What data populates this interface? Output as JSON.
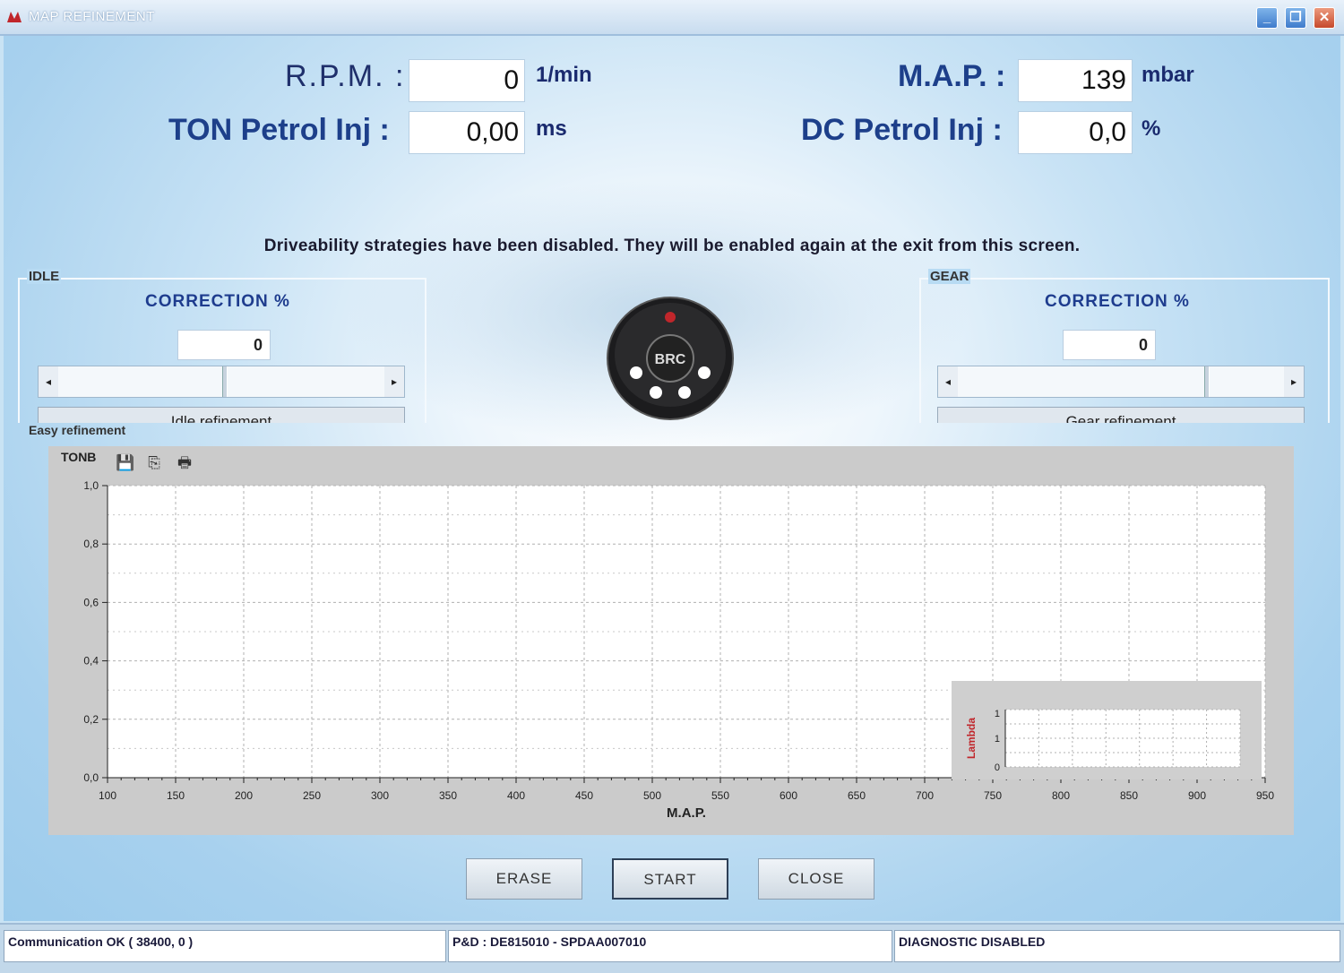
{
  "window": {
    "title": "MAP REFINEMENT"
  },
  "readouts": {
    "rpm": {
      "label": "R.P.M. :",
      "value": "0",
      "unit": "1/min"
    },
    "ton": {
      "label": "TON Petrol Inj :",
      "value": "0,00",
      "unit": "ms"
    },
    "map": {
      "label": "M.A.P. :",
      "value": "139",
      "unit": "mbar"
    },
    "dc": {
      "label": "DC Petrol Inj :",
      "value": "0,0",
      "unit": "%"
    }
  },
  "notice": "Driveability strategies have been disabled. They will be enabled again at the exit from this screen.",
  "idle": {
    "title": "IDLE",
    "correction_label": "CORRECTION %",
    "correction_value": "0",
    "slider_position": 0.5,
    "refine_button": "Idle refinement"
  },
  "gear": {
    "title": "GEAR",
    "correction_label": "CORRECTION %",
    "correction_value": "0",
    "slider_position": 0.75,
    "refine_button": "Gear refinement"
  },
  "logo_text": "BRC",
  "chart_section_label": "Easy refinement",
  "chart_data": [
    {
      "type": "line",
      "title": "TONB",
      "xlabel": "M.A.P.",
      "ylabel": "",
      "xlim": [
        100,
        950
      ],
      "ylim": [
        0.0,
        1.0
      ],
      "x_ticks": [
        "100",
        "150",
        "200",
        "250",
        "300",
        "350",
        "400",
        "450",
        "500",
        "550",
        "600",
        "650",
        "700",
        "750",
        "800",
        "850",
        "900",
        "950"
      ],
      "y_ticks": [
        "0,0",
        "0,2",
        "0,4",
        "0,6",
        "0,8",
        "1,0"
      ],
      "grid": true,
      "series": []
    },
    {
      "type": "line",
      "title": "",
      "xlabel": "",
      "ylabel": "Lambda",
      "y_ticks": [
        "0",
        "1",
        "1"
      ],
      "grid": true,
      "series": []
    }
  ],
  "buttons": {
    "erase": "ERASE",
    "start": "START",
    "close": "CLOSE"
  },
  "status": {
    "communication": "Communication OK ( 38400,  0 )",
    "ecu": "P&D : DE815010 - SPDAA007010",
    "diagnostic": "DIAGNOSTIC DISABLED"
  },
  "icons": {
    "app": "app-icon",
    "minimize": "minimize-icon",
    "maximize": "maximize-icon",
    "close": "close-icon",
    "save": "save-icon",
    "copy": "copy-icon",
    "print": "print-icon"
  }
}
